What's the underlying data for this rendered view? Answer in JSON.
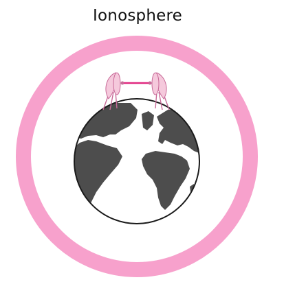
{
  "diagram": {
    "title": "Ionosphere",
    "colors": {
      "ionosphere_ring": "#f7a1cc",
      "globe_ocean": "#ffffff",
      "globe_land": "#4d4d4d",
      "globe_outline": "#1a1a1a",
      "dish": "#f5c9dc",
      "dish_outline": "#c86a98",
      "link_beam": "#e0287f"
    },
    "icons": [
      "ionosphere-ring",
      "earth-globe-icon",
      "satellite-dish-icon",
      "satellite-dish-icon"
    ]
  }
}
